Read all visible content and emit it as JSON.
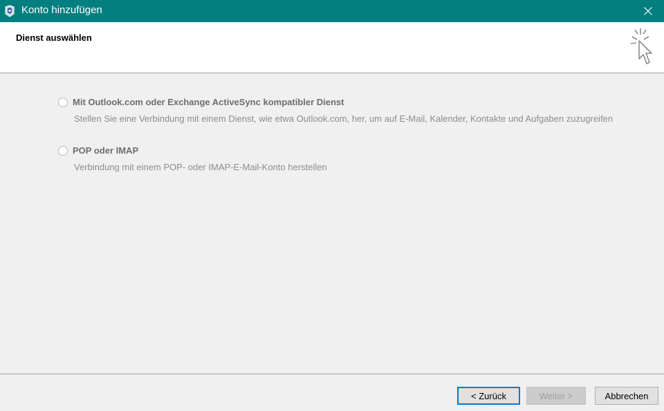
{
  "window": {
    "title": "Konto hinzufügen",
    "titlebar_color": "#037f7f"
  },
  "header": {
    "title": "Dienst auswählen",
    "icon": "wizard-cursor-icon"
  },
  "options": [
    {
      "label": "Mit Outlook.com oder Exchange ActiveSync kompatibler Dienst",
      "description": "Stellen Sie eine Verbindung mit einem Dienst, wie etwa Outlook.com, her, um auf E-Mail, Kalender, Kontakte und Aufgaben zuzugreifen",
      "selected": false
    },
    {
      "label": "POP oder IMAP",
      "description": "Verbindung mit einem POP- oder IMAP-E-Mail-Konto herstellen",
      "selected": false
    }
  ],
  "buttons": {
    "back": "< Zurück",
    "next": "Weiter >",
    "cancel": "Abbrechen",
    "next_enabled": false,
    "focus_color": "#0078d7"
  }
}
